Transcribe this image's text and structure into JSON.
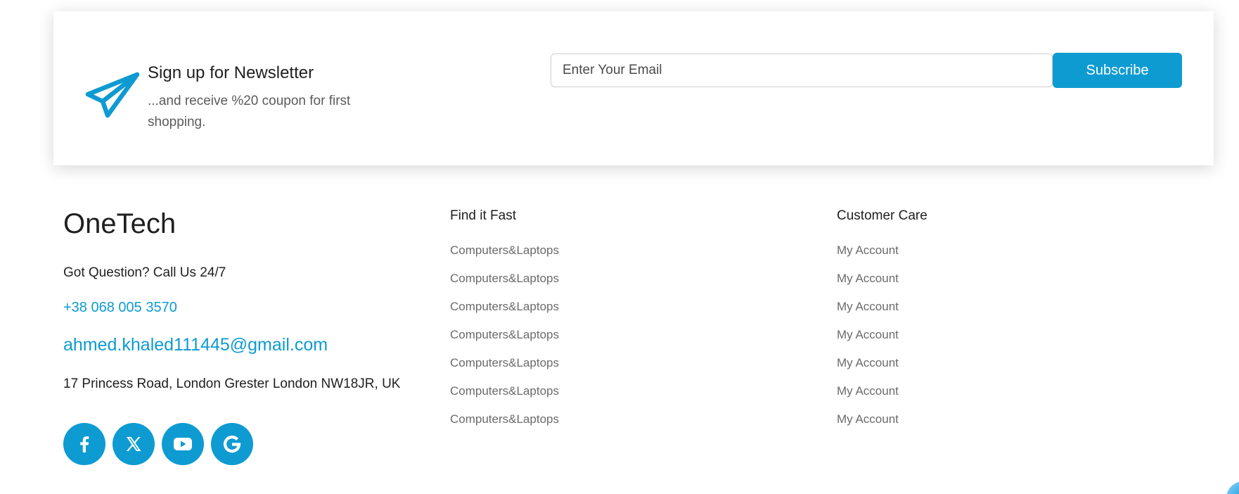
{
  "newsletter": {
    "icon": "paper-plane-icon",
    "title": "Sign up for Newsletter",
    "subtitle": "...and receive %20 coupon for first shopping.",
    "email_placeholder": "Enter Your Email",
    "email_value": "",
    "subscribe_label": "Subscribe"
  },
  "footer": {
    "brand": "OneTech",
    "question": "Got Question? Call Us 24/7",
    "phone": "+38 068 005 3570",
    "email": "ahmed.khaled111445@gmail.com",
    "address": "17 Princess Road, London Grester London NW18JR, UK",
    "socials": [
      "facebook-icon",
      "x-twitter-icon",
      "youtube-icon",
      "google-icon"
    ],
    "find_it_fast": {
      "title": "Find it Fast",
      "items": [
        "Computers&Laptops",
        "Computers&Laptops",
        "Computers&Laptops",
        "Computers&Laptops",
        "Computers&Laptops",
        "Computers&Laptops",
        "Computers&Laptops"
      ]
    },
    "customer_care": {
      "title": "Customer Care",
      "items": [
        "My Account",
        "My Account",
        "My Account",
        "My Account",
        "My Account",
        "My Account",
        "My Account"
      ]
    }
  },
  "colors": {
    "accent": "#0e9bd2",
    "text": "#1f1f1f",
    "muted": "#6b6b6b"
  }
}
